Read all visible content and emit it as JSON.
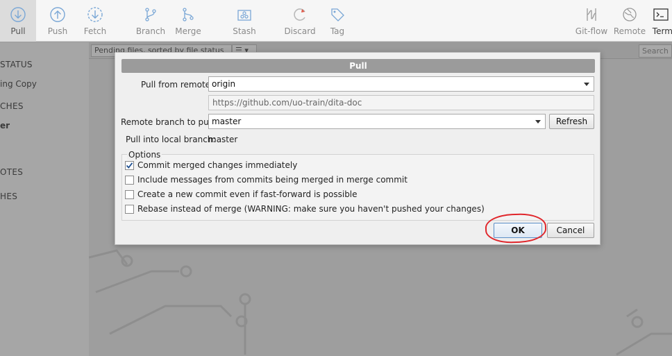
{
  "toolbar": {
    "items": [
      {
        "label": "Pull",
        "icon": "pull-icon",
        "active": true
      },
      {
        "label": "Push",
        "icon": "push-icon"
      },
      {
        "label": "Fetch",
        "icon": "fetch-icon"
      },
      {
        "label": "Branch",
        "icon": "branch-icon"
      },
      {
        "label": "Merge",
        "icon": "merge-icon"
      },
      {
        "label": "Stash",
        "icon": "stash-icon"
      },
      {
        "label": "Discard",
        "icon": "discard-icon"
      },
      {
        "label": "Tag",
        "icon": "tag-icon"
      },
      {
        "label": "Git-flow",
        "icon": "git-flow-icon"
      },
      {
        "label": "Remote",
        "icon": "remote-icon"
      },
      {
        "label": "Termi",
        "icon": "terminal-icon"
      }
    ]
  },
  "sidebar": {
    "items": [
      {
        "label": "STATUS"
      },
      {
        "label": "ing Copy"
      },
      {
        "label": "CHES"
      },
      {
        "label": "er"
      },
      {
        "label": "OTES"
      },
      {
        "label": "HES"
      }
    ]
  },
  "subbar": {
    "filter_select": "Pending files, sorted by file status",
    "search_placeholder": "Search"
  },
  "dialog": {
    "title": "Pull",
    "pull_from_remote_label": "Pull from remote:",
    "remote_value": "origin",
    "remote_url": "https://github.com/uo-train/dita-doc",
    "remote_branch_label": "Remote branch to pull:",
    "remote_branch_value": "master",
    "refresh_label": "Refresh",
    "local_branch_label": "Pull into local branch:",
    "local_branch_value": "master",
    "options_legend": "Options",
    "options": [
      {
        "label": "Commit merged changes immediately",
        "checked": true
      },
      {
        "label": "Include messages from commits being merged in merge commit",
        "checked": false
      },
      {
        "label": "Create a new commit even if fast-forward is possible",
        "checked": false
      },
      {
        "label": "Rebase instead of merge (WARNING: make sure you haven't pushed your changes)",
        "checked": false
      }
    ],
    "ok_label": "OK",
    "cancel_label": "Cancel"
  },
  "colors": {
    "highlight_ring": "#e0262b",
    "title_bar": "#9b9b9b"
  }
}
